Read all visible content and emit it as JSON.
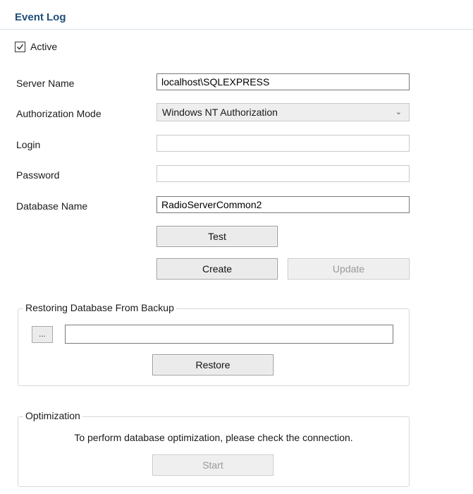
{
  "header": {
    "title": "Event Log"
  },
  "active": {
    "label": "Active",
    "checked": true
  },
  "form": {
    "server_name": {
      "label": "Server Name",
      "value": "localhost\\SQLEXPRESS"
    },
    "auth_mode": {
      "label": "Authorization Mode",
      "value": "Windows NT Authorization"
    },
    "login": {
      "label": "Login",
      "value": ""
    },
    "password": {
      "label": "Password",
      "value": ""
    },
    "database_name": {
      "label": "Database Name",
      "value": "RadioServerCommon2"
    }
  },
  "buttons": {
    "test": "Test",
    "create": "Create",
    "update": "Update"
  },
  "restore": {
    "title": "Restoring Database From Backup",
    "browse": "...",
    "path": "",
    "restore_button": "Restore"
  },
  "optimization": {
    "title": "Optimization",
    "message": "To perform database optimization, please check the connection.",
    "start_button": "Start"
  },
  "icons": {
    "checkbox_check": "check-icon",
    "dropdown": "chevron-down-icon"
  }
}
